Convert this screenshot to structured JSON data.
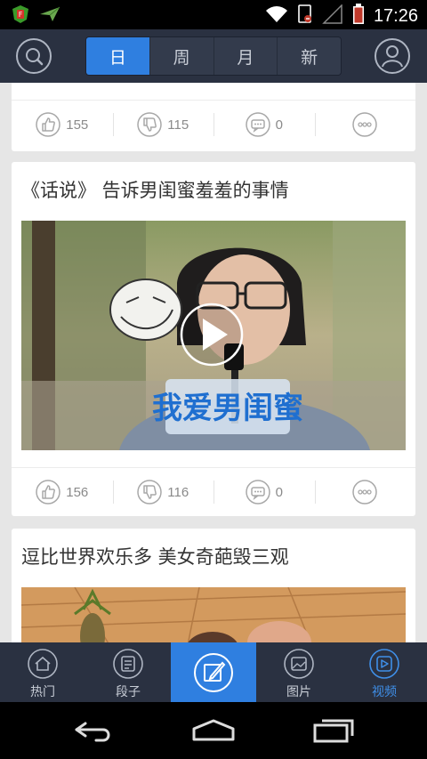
{
  "status_bar": {
    "time": "17:26",
    "icons": [
      "app-notification-icon",
      "paper-plane-icon",
      "wifi-icon",
      "data-off-icon",
      "signal-icon",
      "battery-icon"
    ],
    "colors": {
      "app_icon": "#3a9a2a",
      "battery": "#c0392b"
    }
  },
  "top_bar": {
    "left_icon": "search-icon",
    "right_icon": "user-icon",
    "tabs": [
      {
        "label": "日",
        "active": true
      },
      {
        "label": "周",
        "active": false
      },
      {
        "label": "月",
        "active": false
      },
      {
        "label": "新",
        "active": false
      }
    ],
    "accent": "#2f7fe0"
  },
  "posts": [
    {
      "title": "",
      "likes": "155",
      "dislikes": "115",
      "comments": "0"
    },
    {
      "title": "《话说》 告诉男闺蜜羞羞的事情",
      "likes": "156",
      "dislikes": "116",
      "comments": "0",
      "video_caption": "我爱男闺蜜"
    },
    {
      "title": "逗比世界欢乐多 美女奇葩毁三观"
    }
  ],
  "bottom_nav": {
    "items": [
      {
        "label": "热门",
        "icon": "house-icon",
        "active": false
      },
      {
        "label": "段子",
        "icon": "list-icon",
        "active": false
      },
      {
        "label": "",
        "icon": "compose-icon",
        "active": false
      },
      {
        "label": "图片",
        "icon": "image-icon",
        "active": false
      },
      {
        "label": "视频",
        "icon": "play-icon",
        "active": true
      }
    ]
  },
  "system_nav": {
    "icons": [
      "back-icon",
      "home-icon",
      "recents-icon"
    ]
  }
}
